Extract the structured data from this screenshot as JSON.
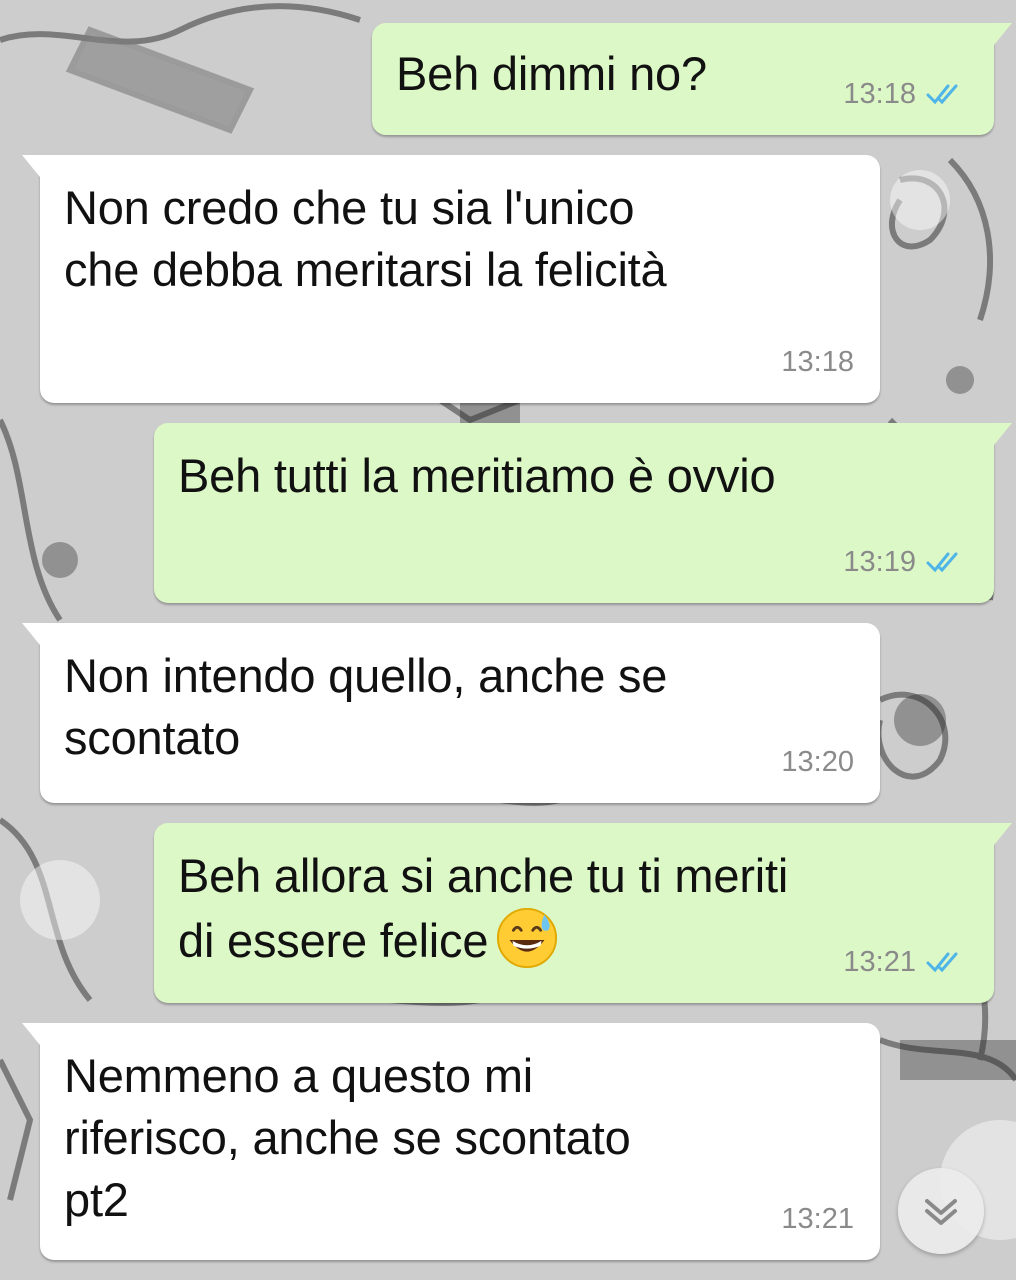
{
  "messages": [
    {
      "id": "m1",
      "direction": "out",
      "lines": "Beh dimmi no?",
      "time": "13:18",
      "status": "read"
    },
    {
      "id": "m2",
      "direction": "in",
      "lines": "Non credo che tu sia l'unico\nche debba meritarsi la felicità",
      "time": "13:18"
    },
    {
      "id": "m3",
      "direction": "out",
      "lines": "Beh tutti la meritiamo è ovvio",
      "time": "13:19",
      "status": "read"
    },
    {
      "id": "m4",
      "direction": "in",
      "lines": "Non intendo quello, anche se\nscontato",
      "time": "13:20"
    },
    {
      "id": "m5",
      "direction": "out",
      "lines": "Beh allora si anche tu ti meriti\ndi essere felice",
      "emoji": "grinning-face-with-sweat",
      "time": "13:21",
      "status": "read"
    },
    {
      "id": "m6",
      "direction": "in",
      "lines": "Nemmeno a questo mi\nriferisco, anche se scontato\npt2",
      "time": "13:21"
    }
  ],
  "icons": {
    "read_ticks": "double-check-icon",
    "scroll": "chevron-double-down-icon"
  },
  "colors": {
    "outgoing_bubble": "#dcf8c6",
    "incoming_bubble": "#ffffff",
    "read_tick": "#4fb5e8",
    "timestamp": "#8a8a8a"
  }
}
